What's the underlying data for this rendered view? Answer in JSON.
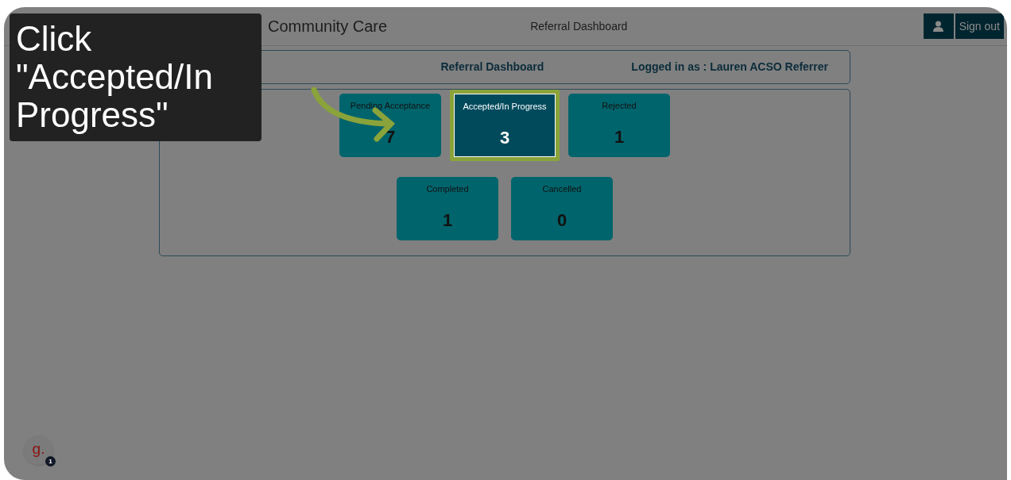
{
  "header": {
    "brand": "Community Care",
    "title": "Referral Dashboard",
    "sign_out": "Sign out"
  },
  "dashboard": {
    "title": "Referral Dashboard",
    "logged_in": "Logged in as : Lauren ACSO Referrer"
  },
  "cards": [
    {
      "label": "Pending Acceptance",
      "count": "7",
      "selected": false
    },
    {
      "label": "Accepted/In Progress",
      "count": "3",
      "selected": true
    },
    {
      "label": "Rejected",
      "count": "1",
      "selected": false
    },
    {
      "label": "Completed",
      "count": "1",
      "selected": false
    },
    {
      "label": "Cancelled",
      "count": "0",
      "selected": false
    }
  ],
  "callout": {
    "text": "Click \"Accepted/In Progress\""
  },
  "assistant": {
    "letter": "g.",
    "badge": "1"
  }
}
